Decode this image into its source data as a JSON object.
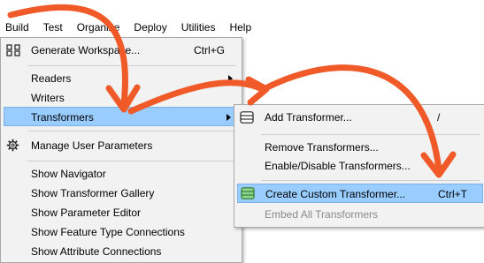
{
  "menubar": {
    "items": [
      "Build",
      "Test",
      "Organize",
      "Deploy",
      "Utilities",
      "Help"
    ]
  },
  "build_menu": {
    "generate_workspace": {
      "label": "Generate Workspace...",
      "shortcut": "Ctrl+G"
    },
    "readers": "Readers",
    "writers": "Writers",
    "transformers": "Transformers",
    "manage_user_parameters": "Manage User Parameters",
    "show_navigator": "Show Navigator",
    "show_transformer_gallery": "Show Transformer Gallery",
    "show_parameter_editor": "Show Parameter Editor",
    "show_feature_type_connections": "Show Feature Type Connections",
    "show_attribute_connections": "Show Attribute Connections"
  },
  "transformers_menu": {
    "add_transformer": {
      "label": "Add Transformer...",
      "shortcut": "/"
    },
    "remove_transformers": "Remove Transformers...",
    "enable_disable_transformers": "Enable/Disable Transformers...",
    "create_custom_transformer": {
      "label": "Create Custom Transformer...",
      "shortcut": "Ctrl+T"
    },
    "embed_all_transformers": "Embed All Transformers"
  },
  "colors": {
    "highlight": "#99ccff",
    "annotation_arrow": "#f05a28",
    "menu_background": "#f2f2f2",
    "disabled_text": "#8a8a8a"
  },
  "icons": [
    "workspace-icon",
    "gear-icon",
    "transformer-stack-icon",
    "custom-transformer-stack-icon",
    "submenu-arrow-icon"
  ]
}
